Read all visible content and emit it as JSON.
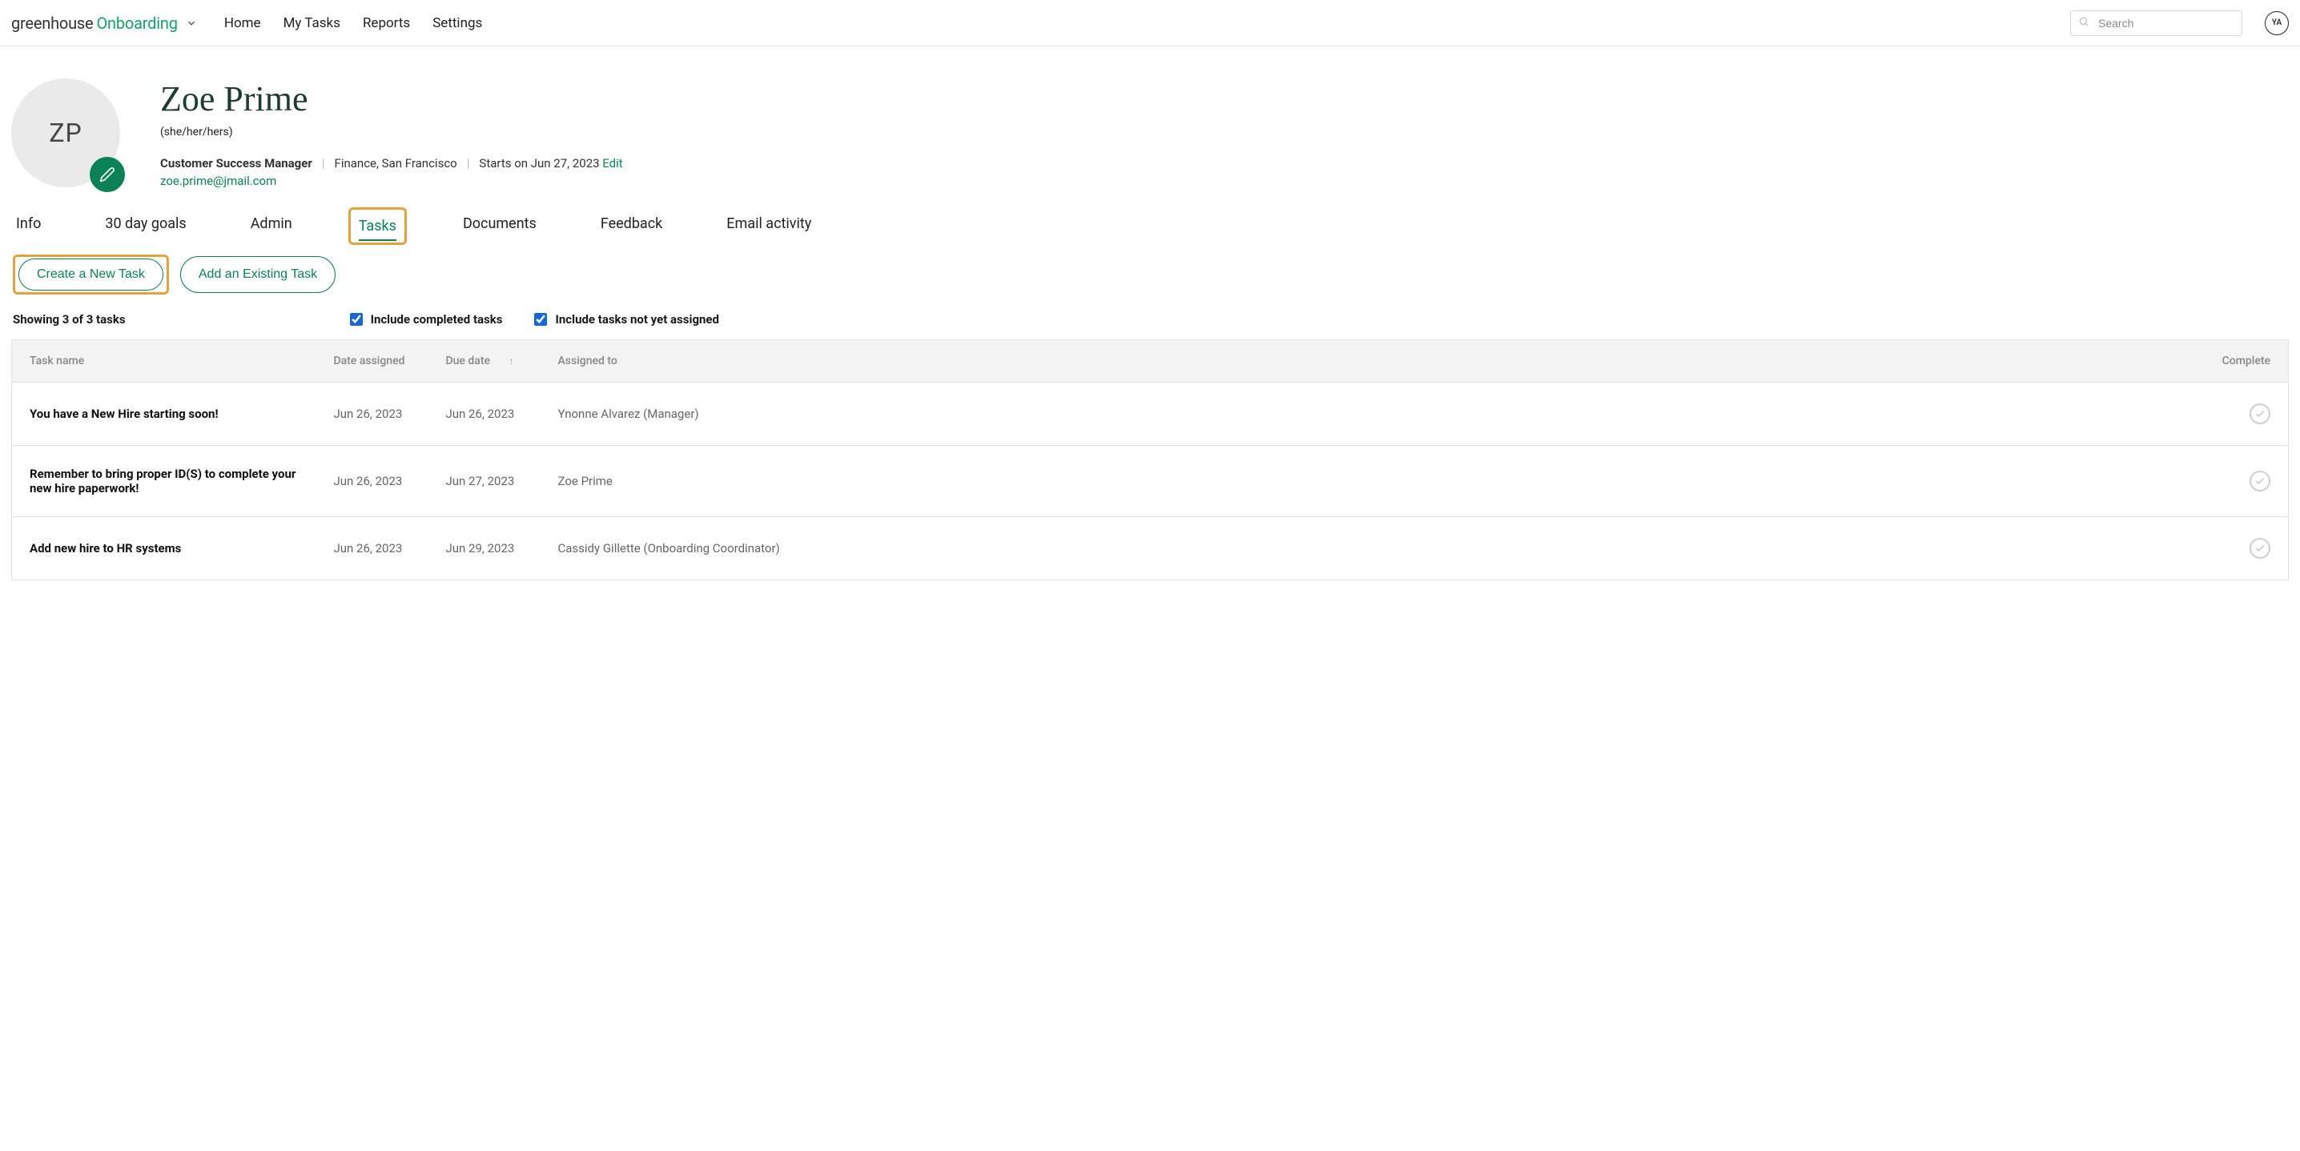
{
  "brand": {
    "main": "greenhouse",
    "sub": "Onboarding"
  },
  "nav": {
    "home": "Home",
    "my_tasks": "My Tasks",
    "reports": "Reports",
    "settings": "Settings"
  },
  "search": {
    "placeholder": "Search"
  },
  "user_avatar": "YA",
  "profile": {
    "initials": "ZP",
    "name": "Zoe Prime",
    "pronouns": "(she/her/hers)",
    "title": "Customer Success Manager",
    "dept_loc": "Finance, San Francisco",
    "start_text": "Starts on Jun 27, 2023",
    "edit": "Edit",
    "email": "zoe.prime@jmail.com"
  },
  "tabs": {
    "info": "Info",
    "goals": "30 day goals",
    "admin": "Admin",
    "tasks": "Tasks",
    "documents": "Documents",
    "feedback": "Feedback",
    "email_activity": "Email activity"
  },
  "actions": {
    "create": "Create a New Task",
    "add_existing": "Add an Existing Task"
  },
  "filters": {
    "showing": "Showing 3 of 3 tasks",
    "include_completed": "Include completed tasks",
    "include_unassigned": "Include tasks not yet assigned"
  },
  "columns": {
    "task_name": "Task name",
    "date_assigned": "Date assigned",
    "due_date": "Due date",
    "assigned_to": "Assigned to",
    "complete": "Complete"
  },
  "rows": [
    {
      "name": "You have a New Hire starting soon!",
      "date_assigned": "Jun 26, 2023",
      "due_date": "Jun 26, 2023",
      "assigned_to": "Ynonne Alvarez (Manager)"
    },
    {
      "name": "Remember to bring proper ID(S) to complete your new hire paperwork!",
      "date_assigned": "Jun 26, 2023",
      "due_date": "Jun 27, 2023",
      "assigned_to": "Zoe Prime"
    },
    {
      "name": "Add new hire to HR systems",
      "date_assigned": "Jun 26, 2023",
      "due_date": "Jun 29, 2023",
      "assigned_to": "Cassidy Gillette (Onboarding Coordinator)"
    }
  ]
}
